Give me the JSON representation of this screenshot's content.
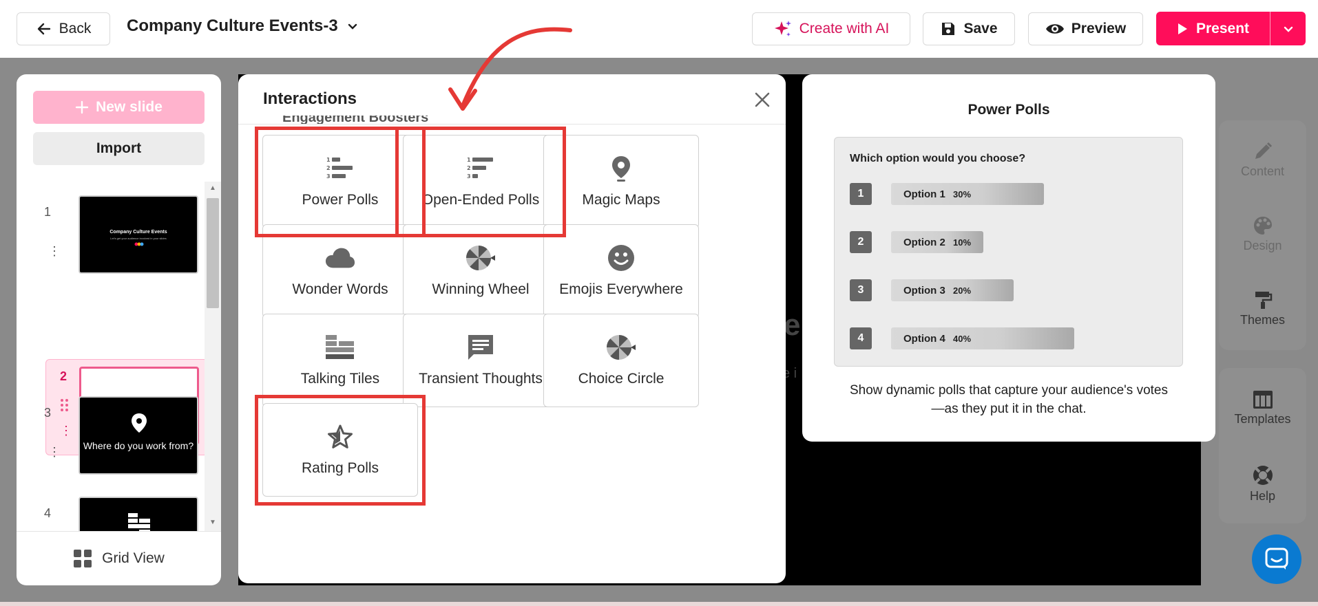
{
  "topbar": {
    "back_label": "Back",
    "deck_title": "Company Culture Events-3",
    "ai_label": "Create with AI",
    "save_label": "Save",
    "preview_label": "Preview",
    "present_label": "Present"
  },
  "sidebar": {
    "new_slide_label": "New slide",
    "import_label": "Import",
    "grid_view_label": "Grid View",
    "slides": [
      {
        "num": "1",
        "title": "Company Culture Events",
        "subtitle": "Let's get your audience involved in your slides"
      },
      {
        "num": "2"
      },
      {
        "num": "3",
        "question": "Where do you work from?"
      },
      {
        "num": "4"
      }
    ]
  },
  "modal": {
    "title": "Interactions",
    "section_peek": "Engagement Boosters",
    "tiles": [
      {
        "label": "Power Polls",
        "icon": "numbered-list-icon"
      },
      {
        "label": "Open-Ended Polls",
        "icon": "open-list-icon"
      },
      {
        "label": "Magic Maps",
        "icon": "map-pin-icon"
      },
      {
        "label": "Wonder Words",
        "icon": "cloud-icon"
      },
      {
        "label": "Winning Wheel",
        "icon": "wheel-icon"
      },
      {
        "label": "Emojis Everywhere",
        "icon": "smiley-icon"
      },
      {
        "label": "Talking Tiles",
        "icon": "tiles-icon"
      },
      {
        "label": "Transient Thoughts",
        "icon": "speech-bubble-icon"
      },
      {
        "label": "Choice Circle",
        "icon": "circle-wheel-icon"
      },
      {
        "label": "Rating Polls",
        "icon": "star-icon"
      }
    ]
  },
  "preview": {
    "title": "Power Polls",
    "question": "Which option would you choose?",
    "options": [
      {
        "idx": "1",
        "label": "Option 1",
        "pct": "30%",
        "value": 30
      },
      {
        "idx": "2",
        "label": "Option 2",
        "pct": "10%",
        "value": 10
      },
      {
        "idx": "3",
        "label": "Option 3",
        "pct": "20%",
        "value": 20
      },
      {
        "idx": "4",
        "label": "Option 4",
        "pct": "40%",
        "value": 40
      }
    ],
    "description": "Show dynamic polls that capture your audience's votes—as they put it in the chat."
  },
  "rail": {
    "content": "Content",
    "design": "Design",
    "themes": "Themes",
    "templates": "Templates",
    "help": "Help"
  },
  "colors": {
    "brand_pink": "#ff0d5a",
    "highlight_red": "#e53935",
    "annotation_arrow": "#e53935"
  }
}
